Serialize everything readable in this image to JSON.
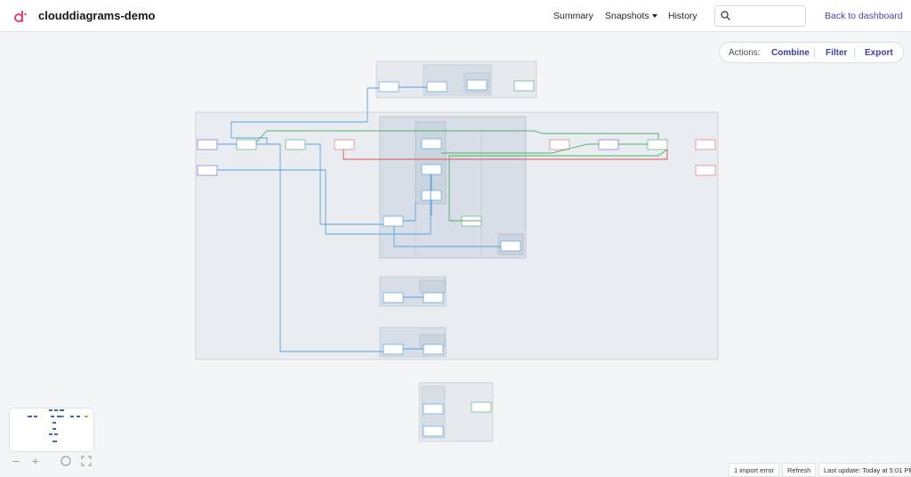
{
  "app": {
    "title": "clouddiagrams-demo",
    "brand_color": "#e0446a"
  },
  "nav": {
    "summary": "Summary",
    "snapshots": "Snapshots",
    "history": "History",
    "search_placeholder": "",
    "back": "Back to dashboard"
  },
  "actions": {
    "label": "Actions:",
    "combine": "Combine",
    "filter": "Filter",
    "export": "Export"
  },
  "status": {
    "errors": "1 import error",
    "refresh": "Refresh",
    "last_update_label": "Last update:",
    "last_update_value": "Today at 5:01 PM"
  },
  "colors": {
    "link": "#4147b8",
    "edge_blue": "#5aa0dc",
    "edge_green": "#4caf6a",
    "edge_red": "#d9534f",
    "node_purple": "#8d6ad8",
    "node_green": "#5bb37a",
    "node_red": "#e07a7a"
  },
  "icons": {
    "logo": "clouddiagrams-logo-icon",
    "search": "search-icon",
    "caret": "chevron-down-icon",
    "zoom_out": "zoom-out-icon",
    "zoom_in": "zoom-in-icon",
    "center": "center-view-icon",
    "fullscreen": "fullscreen-icon"
  }
}
